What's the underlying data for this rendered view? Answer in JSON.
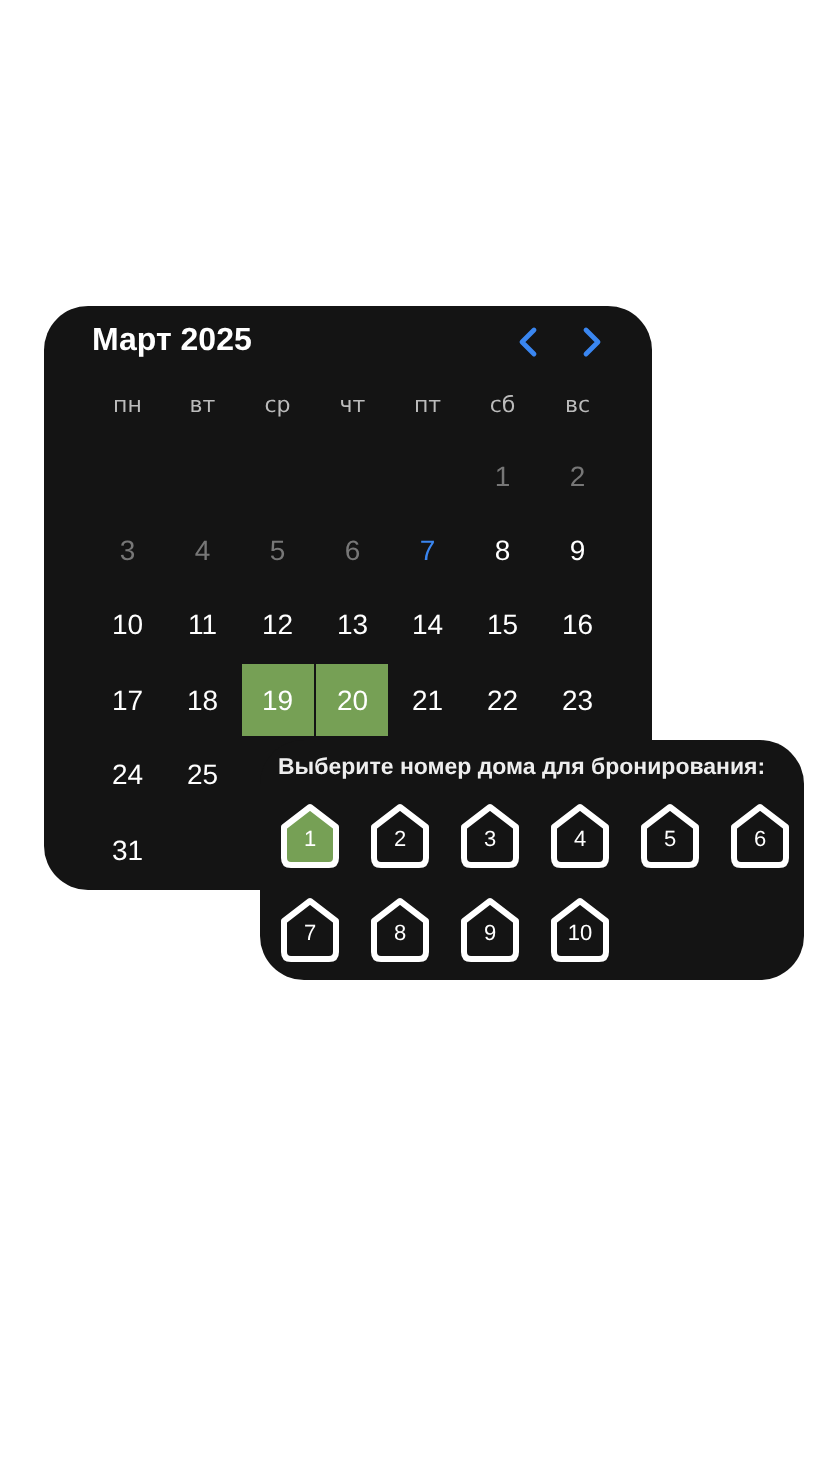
{
  "calendar": {
    "title": "Март 2025",
    "weekdays": [
      "пн",
      "вт",
      "ср",
      "чт",
      "пт",
      "сб",
      "вс"
    ],
    "weeks": [
      [
        {
          "kind": "blank"
        },
        {
          "kind": "blank"
        },
        {
          "kind": "blank"
        },
        {
          "kind": "blank"
        },
        {
          "kind": "blank"
        },
        {
          "day": "1",
          "kind": "past",
          "selected": false
        },
        {
          "day": "2",
          "kind": "past",
          "selected": false
        }
      ],
      [
        {
          "day": "3",
          "kind": "past",
          "selected": false
        },
        {
          "day": "4",
          "kind": "past",
          "selected": false
        },
        {
          "day": "5",
          "kind": "past",
          "selected": false
        },
        {
          "day": "6",
          "kind": "past",
          "selected": false
        },
        {
          "day": "7",
          "kind": "today",
          "selected": false
        },
        {
          "day": "8",
          "kind": "normal",
          "selected": false
        },
        {
          "day": "9",
          "kind": "normal",
          "selected": false
        }
      ],
      [
        {
          "day": "10",
          "kind": "normal",
          "selected": false
        },
        {
          "day": "11",
          "kind": "normal",
          "selected": false
        },
        {
          "day": "12",
          "kind": "normal",
          "selected": false
        },
        {
          "day": "13",
          "kind": "normal",
          "selected": false
        },
        {
          "day": "14",
          "kind": "normal",
          "selected": false
        },
        {
          "day": "15",
          "kind": "normal",
          "selected": false
        },
        {
          "day": "16",
          "kind": "normal",
          "selected": false
        }
      ],
      [
        {
          "day": "17",
          "kind": "normal",
          "selected": false
        },
        {
          "day": "18",
          "kind": "normal",
          "selected": false
        },
        {
          "day": "19",
          "kind": "normal",
          "selected": true
        },
        {
          "day": "20",
          "kind": "normal",
          "selected": true
        },
        {
          "day": "21",
          "kind": "normal",
          "selected": false
        },
        {
          "day": "22",
          "kind": "normal",
          "selected": false
        },
        {
          "day": "23",
          "kind": "normal",
          "selected": false
        }
      ],
      [
        {
          "day": "24",
          "kind": "normal",
          "selected": false
        },
        {
          "day": "25",
          "kind": "normal",
          "selected": false
        },
        {
          "kind": "blank"
        },
        {
          "kind": "blank"
        },
        {
          "kind": "blank"
        },
        {
          "kind": "blank"
        },
        {
          "kind": "blank"
        }
      ],
      [
        {
          "day": "31",
          "kind": "normal",
          "selected": false
        }
      ]
    ]
  },
  "house_picker": {
    "title": "Выберите номер дома для бронирования:",
    "houses": [
      {
        "label": "1",
        "selected": true
      },
      {
        "label": "2",
        "selected": false
      },
      {
        "label": "3",
        "selected": false
      },
      {
        "label": "4",
        "selected": false
      },
      {
        "label": "5",
        "selected": false
      },
      {
        "label": "6",
        "selected": false
      },
      {
        "label": "7",
        "selected": false
      },
      {
        "label": "8",
        "selected": false
      },
      {
        "label": "9",
        "selected": false
      },
      {
        "label": "10",
        "selected": false
      }
    ]
  }
}
